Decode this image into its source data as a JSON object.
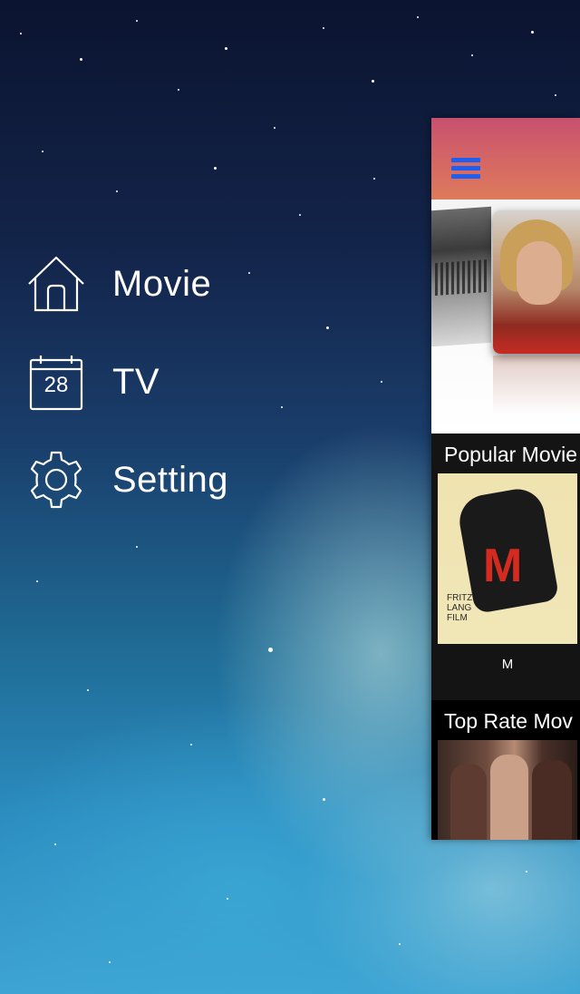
{
  "drawer": {
    "items": [
      {
        "label": "Movie",
        "icon": "home-icon"
      },
      {
        "label": "TV",
        "icon": "calendar-icon",
        "icon_text": "28"
      },
      {
        "label": "Setting",
        "icon": "gear-icon"
      }
    ]
  },
  "main": {
    "nav_bar": {
      "menu_icon": "hamburger-menu-icon",
      "accent": "#1f5ff0"
    },
    "sections": [
      {
        "title": "Popular Movie",
        "items": [
          {
            "caption": "M",
            "poster_text": "FRITZ LANG FILM"
          }
        ]
      },
      {
        "title": "Top Rate Mov"
      }
    ]
  },
  "colors": {
    "nav_gradient_top": "#c8506f",
    "nav_gradient_bottom": "#de7a5c",
    "menu_text": "#ffffff"
  }
}
